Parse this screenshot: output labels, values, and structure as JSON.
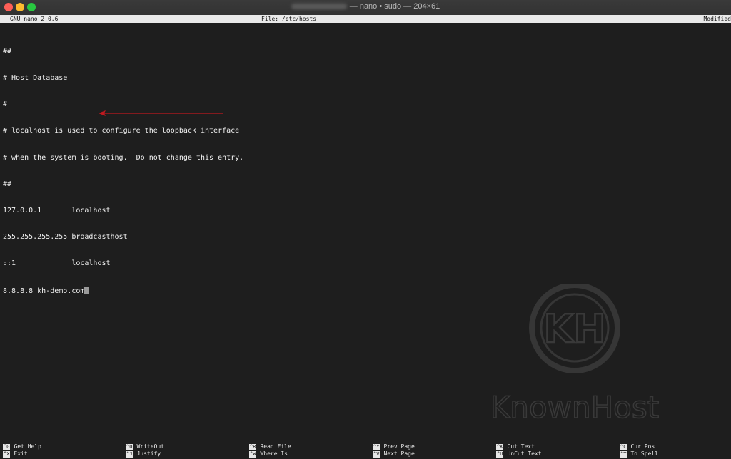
{
  "window": {
    "title_suffix": "— nano • sudo — 204×61"
  },
  "nano": {
    "version": "GNU nano 2.0.6",
    "file": "File: /etc/hosts",
    "status": "Modified"
  },
  "editor": {
    "lines": [
      "##",
      "# Host Database",
      "#",
      "# localhost is used to configure the loopback interface",
      "# when the system is booting.  Do not change this entry.",
      "##",
      "127.0.0.1       localhost",
      "255.255.255.255 broadcasthost",
      "::1             localhost",
      "8.8.8.8 kh-demo.com"
    ]
  },
  "shortcuts": [
    {
      "key": "^G",
      "label": "Get Help"
    },
    {
      "key": "^X",
      "label": "Exit"
    },
    {
      "key": "^O",
      "label": "WriteOut"
    },
    {
      "key": "^J",
      "label": "Justify"
    },
    {
      "key": "^R",
      "label": "Read File"
    },
    {
      "key": "^W",
      "label": "Where Is"
    },
    {
      "key": "^Y",
      "label": "Prev Page"
    },
    {
      "key": "^V",
      "label": "Next Page"
    },
    {
      "key": "^K",
      "label": "Cut Text"
    },
    {
      "key": "^U",
      "label": "UnCut Text"
    },
    {
      "key": "^C",
      "label": "Cur Pos"
    },
    {
      "key": "^T",
      "label": "To Spell"
    }
  ],
  "watermark": {
    "logo_text": "KH",
    "brand": "KnownHost"
  },
  "colors": {
    "background": "#1e1e1e",
    "annotation_arrow": "#c0191f",
    "close": "#ff5f57",
    "minimize": "#febc2e",
    "maximize": "#28c840"
  }
}
